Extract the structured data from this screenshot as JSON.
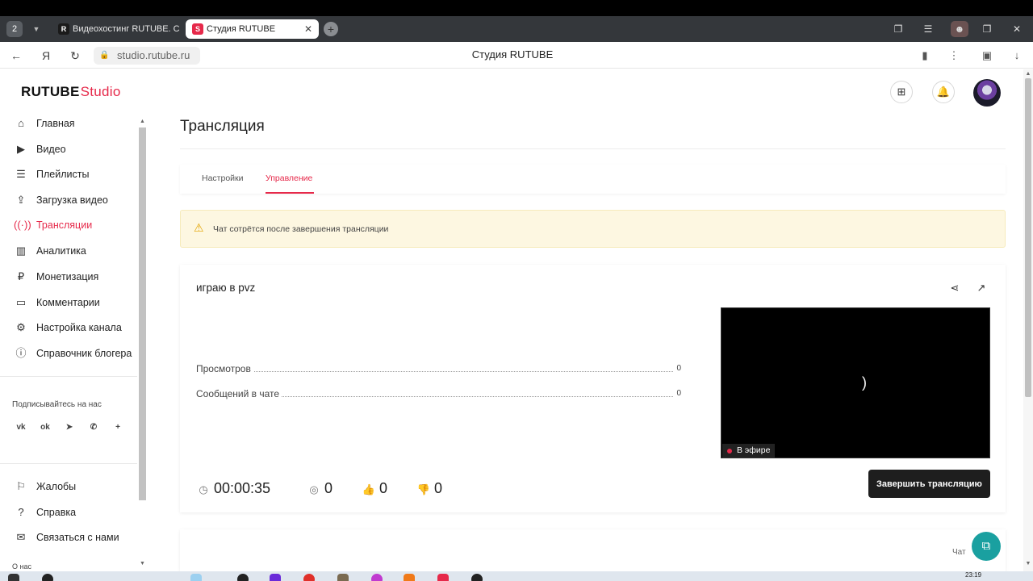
{
  "browser": {
    "tab_counter": "2",
    "tabs": [
      {
        "label": "Видеохостинг RUTUBE. С",
        "favicon": "R"
      },
      {
        "label": "Студия RUTUBE",
        "favicon": "S"
      }
    ],
    "url": "studio.rutube.ru",
    "page_title": "Студия RUTUBE"
  },
  "header": {
    "logo_main": "RUTUBE",
    "logo_sub": "Studio"
  },
  "sidebar": {
    "items": [
      {
        "label": "Главная",
        "icon": "home-icon"
      },
      {
        "label": "Видео",
        "icon": "video-icon"
      },
      {
        "label": "Плейлисты",
        "icon": "list-icon"
      },
      {
        "label": "Загрузка видео",
        "icon": "upload-icon"
      },
      {
        "label": "Трансляции",
        "icon": "broadcast-icon"
      },
      {
        "label": "Аналитика",
        "icon": "analytics-icon"
      },
      {
        "label": "Монетизация",
        "icon": "ruble-icon"
      },
      {
        "label": "Комментарии",
        "icon": "comment-icon"
      },
      {
        "label": "Настройка канала",
        "icon": "gear-icon"
      },
      {
        "label": "Справочник блогера",
        "icon": "info-icon"
      }
    ],
    "subscribe_label": "Подписывайтесь на нас",
    "socials": [
      "vk-icon",
      "ok-icon",
      "telegram-icon",
      "viber-icon",
      "plus-icon"
    ],
    "bottom_items": [
      {
        "label": "Жалобы",
        "icon": "flag-icon"
      },
      {
        "label": "Справка",
        "icon": "help-icon"
      },
      {
        "label": "Связаться с нами",
        "icon": "mail-icon"
      }
    ],
    "about": "О нас"
  },
  "main": {
    "title": "Трансляция",
    "tabs": [
      "Настройки",
      "Управление"
    ],
    "active_tab": "Управление",
    "warning": "Чат сотрётся после завершения трансляции",
    "stream": {
      "name": "играю в pvz",
      "stats": [
        {
          "label": "Просмотров",
          "value": "0"
        },
        {
          "label": "Сообщений в чате",
          "value": "0"
        }
      ],
      "live_label": "В эфире",
      "spinner": ")",
      "timer": "00:00:35",
      "viewers": "0",
      "likes": "0",
      "dislikes": "0",
      "end_button": "Завершить трансляцию"
    },
    "chat_label": "Чат"
  },
  "taskbar": {
    "time": "23:19"
  },
  "colors": {
    "accent": "#e6294a",
    "warning_bg": "#fdf7e1",
    "fab": "#1aa0a0"
  }
}
